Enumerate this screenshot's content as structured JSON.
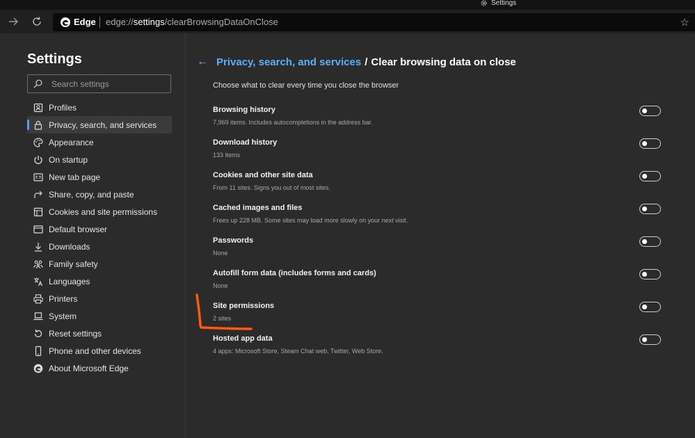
{
  "titlebar": {
    "tab_title": "Settings"
  },
  "address_bar": {
    "brand": "Edge",
    "url_scheme": "edge://",
    "url_host": "settings",
    "url_path": "/clearBrowsingDataOnClose",
    "icons": [
      "back-arrow-icon",
      "refresh-icon",
      "edge-logo-icon",
      "favorite-star-icon"
    ]
  },
  "sidebar": {
    "title": "Settings",
    "search_placeholder": "Search settings",
    "items": [
      {
        "label": "Profiles",
        "icon": "profile-icon"
      },
      {
        "label": "Privacy, search, and services",
        "icon": "lock-icon",
        "active": true
      },
      {
        "label": "Appearance",
        "icon": "palette-icon"
      },
      {
        "label": "On startup",
        "icon": "power-icon"
      },
      {
        "label": "New tab page",
        "icon": "new-tab-icon"
      },
      {
        "label": "Share, copy, and paste",
        "icon": "share-icon"
      },
      {
        "label": "Cookies and site permissions",
        "icon": "cookies-icon"
      },
      {
        "label": "Default browser",
        "icon": "browser-icon"
      },
      {
        "label": "Downloads",
        "icon": "download-icon"
      },
      {
        "label": "Family safety",
        "icon": "family-icon"
      },
      {
        "label": "Languages",
        "icon": "language-icon"
      },
      {
        "label": "Printers",
        "icon": "printer-icon"
      },
      {
        "label": "System",
        "icon": "laptop-icon"
      },
      {
        "label": "Reset settings",
        "icon": "reset-icon"
      },
      {
        "label": "Phone and other devices",
        "icon": "phone-icon"
      },
      {
        "label": "About Microsoft Edge",
        "icon": "edge-logo-icon"
      }
    ]
  },
  "main": {
    "breadcrumb_parent": "Privacy, search, and services",
    "breadcrumb_separator": "/",
    "breadcrumb_current": "Clear browsing data on close",
    "subtitle": "Choose what to clear every time you close the browser",
    "options": [
      {
        "label": "Browsing history",
        "desc": "7,969 items. Includes autocompletions in the address bar.",
        "on": false
      },
      {
        "label": "Download history",
        "desc": "133 items",
        "on": false
      },
      {
        "label": "Cookies and other site data",
        "desc": "From 11 sites. Signs you out of most sites.",
        "on": false
      },
      {
        "label": "Cached images and files",
        "desc": "Frees up 228 MB. Some sites may load more slowly on your next visit.",
        "on": false
      },
      {
        "label": "Passwords",
        "desc": "None",
        "on": false
      },
      {
        "label": "Autofill form data (includes forms and cards)",
        "desc": "None",
        "on": false
      },
      {
        "label": "Site permissions",
        "desc": "2 sites",
        "on": false
      },
      {
        "label": "Hosted app data",
        "desc": "4 apps: Microsoft Store, Steam Chat web, Twitter, Web Store.",
        "on": false
      }
    ]
  },
  "colors": {
    "accent": "#5ab0f8",
    "annotation": "#ff5a0a",
    "background": "#2b2b2b"
  }
}
